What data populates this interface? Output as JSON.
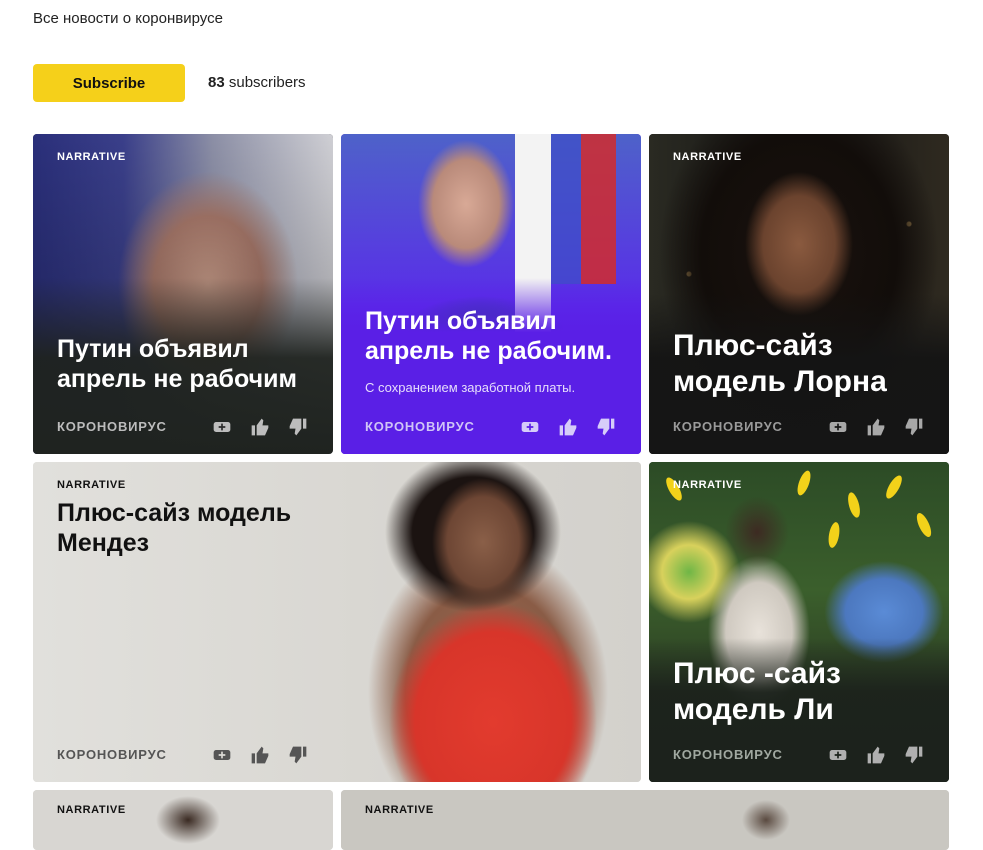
{
  "channel": {
    "description": "Все новости о коронвирусе",
    "subscribe_label": "Subscribe",
    "subscribers_count": "83",
    "subscribers_label": "subscribers"
  },
  "cards": [
    {
      "label": "NARRATIVE",
      "title": "Путин объявил апрель не рабочим",
      "subtitle": "",
      "tag": "КОРОНОВИРУС"
    },
    {
      "label": "",
      "title": "Путин объявил апрель не рабочим.",
      "subtitle": "С сохранением заработной платы.",
      "tag": "КОРОНОВИРУС"
    },
    {
      "label": "NARRATIVE",
      "title": "Плюс-сайз модель Лорна",
      "subtitle": "",
      "tag": "КОРОНОВИРУС"
    },
    {
      "label": "NARRATIVE",
      "title": "Плюс-сайз модель Мендез",
      "subtitle": "",
      "tag": "КОРОНОВИРУС"
    },
    {
      "label": "NARRATIVE",
      "title": "Плюс -сайз модель Ли",
      "subtitle": "",
      "tag": "КОРОНОВИРУС"
    },
    {
      "label": "NARRATIVE"
    },
    {
      "label": "NARRATIVE"
    }
  ],
  "colors": {
    "subscribe_accent": "#f5d01a",
    "card_purple": "#5a1fe6"
  },
  "icons": {
    "add": "add-to-collection-icon",
    "like": "thumbs-up-icon",
    "dislike": "thumbs-down-icon"
  }
}
